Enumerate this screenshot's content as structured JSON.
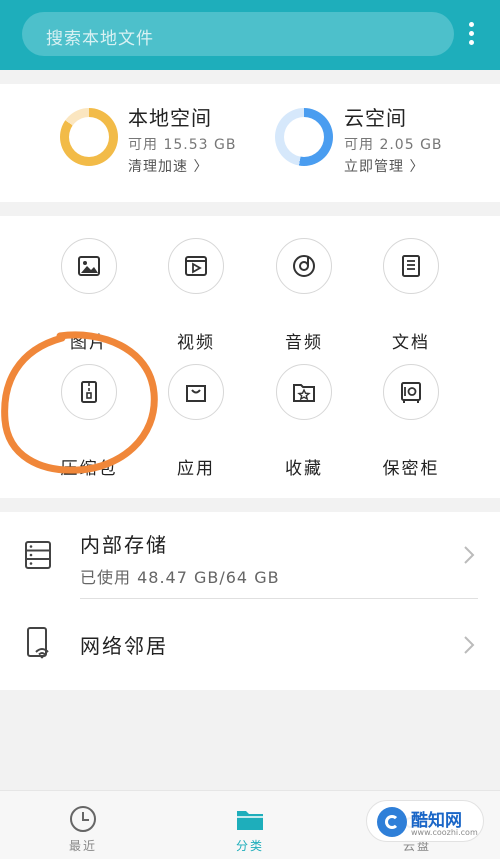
{
  "header": {
    "search_placeholder": "搜索本地文件",
    "colors": {
      "header_bg": "#1eaebb",
      "search_bg": "#4dc0cb"
    }
  },
  "storage": {
    "local": {
      "title": "本地空间",
      "available": "可用 15.53 GB",
      "action": "清理加速 〉",
      "color": "#f2bb48"
    },
    "cloud": {
      "title": "云空间",
      "available": "可用 2.05 GB",
      "action": "立即管理 〉",
      "color": "#4a9df0"
    }
  },
  "categories": [
    {
      "label": "图片",
      "icon": "image-icon"
    },
    {
      "label": "视频",
      "icon": "video-icon"
    },
    {
      "label": "音频",
      "icon": "audio-icon"
    },
    {
      "label": "文档",
      "icon": "document-icon"
    },
    {
      "label": "压缩包",
      "icon": "archive-icon"
    },
    {
      "label": "应用",
      "icon": "app-bag-icon"
    },
    {
      "label": "收藏",
      "icon": "favorites-folder-icon"
    },
    {
      "label": "保密柜",
      "icon": "safe-icon"
    }
  ],
  "storage_list": {
    "internal": {
      "title": "内部存储",
      "usage": "已使用 48.47 GB/64 GB"
    },
    "network": {
      "title": "网络邻居"
    }
  },
  "bottom_nav": [
    {
      "label": "最近",
      "icon": "clock-icon",
      "active": false
    },
    {
      "label": "分类",
      "icon": "folder-icon",
      "active": true
    },
    {
      "label": "云盘",
      "icon": "cloud-drive-icon",
      "active": false
    }
  ],
  "annotation_color": "#f0873a",
  "watermark": {
    "name": "酷知网",
    "url": "www.coozhi.com"
  }
}
